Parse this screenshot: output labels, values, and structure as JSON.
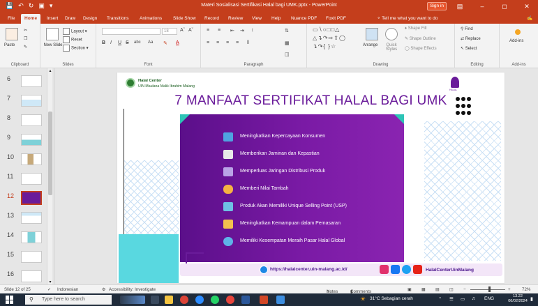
{
  "titlebar": {
    "title": "Materi Sosialisasi Sertifikasi Halal bagi UMK.pptx  -  PowerPoint",
    "sign_in": "Sign in",
    "quick_access": [
      "save-icon",
      "undo-icon",
      "redo-icon",
      "present-icon",
      "customize-icon"
    ]
  },
  "tabs": [
    "File",
    "Home",
    "Insert",
    "Draw",
    "Design",
    "Transitions",
    "Animations",
    "Slide Show",
    "Record",
    "Review",
    "View",
    "Help",
    "Nuance PDF",
    "Foxit PDF"
  ],
  "active_tab": "Home",
  "tell_me": "Tell me what you want to do",
  "ribbon": {
    "clipboard": {
      "label": "Clipboard",
      "paste": "Paste"
    },
    "slides": {
      "label": "Slides",
      "new_slide": "New Slide",
      "layout": "Layout",
      "reset": "Reset",
      "section": "Section"
    },
    "font": {
      "label": "Font",
      "font_size": "18",
      "bold": "B",
      "italic": "I",
      "underline": "U",
      "strike": "S",
      "shadow": "abc",
      "case": "Aa",
      "color": "A"
    },
    "paragraph": {
      "label": "Paragraph"
    },
    "drawing": {
      "label": "Drawing",
      "arrange": "Arrange",
      "quick_styles": "Quick Styles",
      "shape_fill": "Shape Fill",
      "shape_outline": "Shape Outline",
      "shape_effects": "Shape Effects"
    },
    "editing": {
      "label": "Editing",
      "find": "Find",
      "replace": "Replace",
      "select": "Select"
    },
    "addins": {
      "label": "Add-ins",
      "addins": "Add-ins"
    }
  },
  "thumbnails": {
    "numbers": [
      "6",
      "7",
      "8",
      "9",
      "10",
      "11",
      "12",
      "13",
      "14",
      "15",
      "16"
    ],
    "selected": "12"
  },
  "slide": {
    "org_line1": "Halal Center",
    "org_line2": "UIN Maulana Malik Ibrahim Malang",
    "halal_label": "HALAL",
    "title": "7 MANFAAT SERTIFIKAT HALAL BAGI UMK",
    "items": [
      "Meningkatkan Kepercayaan Konsumen",
      "Memberikan Jaminan dan Kepastian",
      "Memperluas Jaringan Distribusi Produk",
      "Memberi Nilai Tambah",
      "Produk Akan Memiliki Unique Selling Point (USP)",
      "Meningkatkan Kemampuan dalam Pemasaran",
      "Memiliki Kesempatan Meraih Pasar Halal Global"
    ],
    "url": "https://halalcenter.uin-malang.ac.id/",
    "social_handle": "HalalCenterUinMalang",
    "colors": {
      "purple": "#6a1b9a",
      "teal": "#59d8e0"
    }
  },
  "status": {
    "slide_count": "Slide 12 of 25",
    "language": "Indonesian",
    "accessibility": "Accessibility: Investigate",
    "notes": "Notes",
    "comments": "Comments",
    "zoom": "72%",
    "zoom_minus": "−",
    "zoom_plus": "+"
  },
  "taskbar": {
    "search_placeholder": "Type here to search",
    "weather": "31°C  Sebagian cerah",
    "lang": "ENG",
    "time": "13.22",
    "date": "06/02/2024"
  },
  "accent_color": "#c43e1c"
}
